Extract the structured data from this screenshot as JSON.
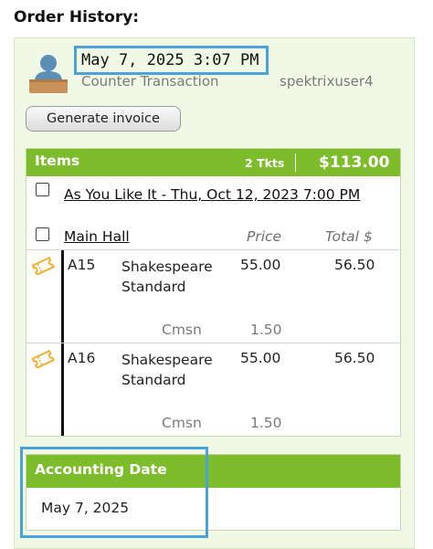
{
  "page": {
    "title": "Order History:"
  },
  "transaction": {
    "timestamp": "May 7, 2025 3:07 PM",
    "type": "Counter Transaction",
    "user": "spektrixuser4"
  },
  "buttons": {
    "generate_invoice": "Generate invoice"
  },
  "items": {
    "title": "Items",
    "ticket_count": "2 Tkts",
    "total": "$113.00",
    "event": "As You Like It - Thu, Oct 12, 2023 7:00 PM",
    "venue": "Main Hall",
    "columns": {
      "price": "Price",
      "total": "Total $"
    },
    "tickets": [
      {
        "seat": "A15",
        "price_type": "Shakespeare Standard",
        "price": "55.00",
        "total": "56.50",
        "commission_label": "Cmsn",
        "commission": "1.50"
      },
      {
        "seat": "A16",
        "price_type": "Shakespeare Standard",
        "price": "55.00",
        "total": "56.50",
        "commission_label": "Cmsn",
        "commission": "1.50"
      }
    ]
  },
  "accounting": {
    "title": "Accounting Date",
    "date": "May 7, 2025"
  },
  "colors": {
    "header_green": "#7dbd2c",
    "panel_bg": "#f1f8e6",
    "highlight": "#4aa3d8",
    "ticket_icon": "#f0b030"
  }
}
